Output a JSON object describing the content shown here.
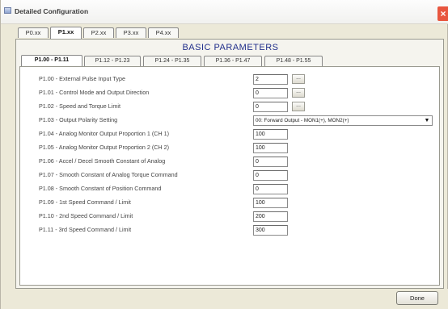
{
  "window": {
    "title": "Detailed Configuration",
    "close_glyph": "×"
  },
  "top_tabs": [
    {
      "label": "P0.xx",
      "active": false
    },
    {
      "label": "P1.xx",
      "active": true
    },
    {
      "label": "P2.xx",
      "active": false
    },
    {
      "label": "P3.xx",
      "active": false
    },
    {
      "label": "P4.xx",
      "active": false
    }
  ],
  "panel": {
    "title": "BASIC PARAMETERS"
  },
  "sub_tabs": [
    {
      "label": "P1.00 - P1.11",
      "active": true
    },
    {
      "label": "P1.12 - P1.23",
      "active": false
    },
    {
      "label": "P1.24 - P1.35",
      "active": false
    },
    {
      "label": "P1.36 - P1.47",
      "active": false
    },
    {
      "label": "P1.48 - P1.55",
      "active": false
    }
  ],
  "params": [
    {
      "label": "P1.00 - External Pulse Input Type",
      "value": "2",
      "has_button": true,
      "button_label": "..."
    },
    {
      "label": "P1.01 - Control Mode and Output Direction",
      "value": "0",
      "has_button": true,
      "button_label": "..."
    },
    {
      "label": "P1.02 - Speed and Torque Limit",
      "value": "0",
      "has_button": true,
      "button_label": "..."
    },
    {
      "label": "P1.03 - Output Polarity Setting",
      "value": "00: Forward Output - MON1(+), MON2(+)",
      "is_select": true,
      "arrow": "▼"
    },
    {
      "label": "P1.04 - Analog Monitor Output Proportion 1 (CH 1)",
      "value": "100"
    },
    {
      "label": "P1.05 - Analog Monitor Output Proportion 2 (CH 2)",
      "value": "100"
    },
    {
      "label": "P1.06 - Accel / Decel Smooth Constant of Analog",
      "value": "0"
    },
    {
      "label": "P1.07 - Smooth Constant of Analog Torque Command",
      "value": "0"
    },
    {
      "label": "P1.08 - Smooth Constant of Position Command",
      "value": "0"
    },
    {
      "label": "P1.09 - 1st Speed Command / Limit",
      "value": "100"
    },
    {
      "label": "P1.10 - 2nd Speed Command / Limit",
      "value": "200"
    },
    {
      "label": "P1.11 - 3rd Speed Command / Limit",
      "value": "300"
    }
  ],
  "footer": {
    "done_label": "Done"
  }
}
